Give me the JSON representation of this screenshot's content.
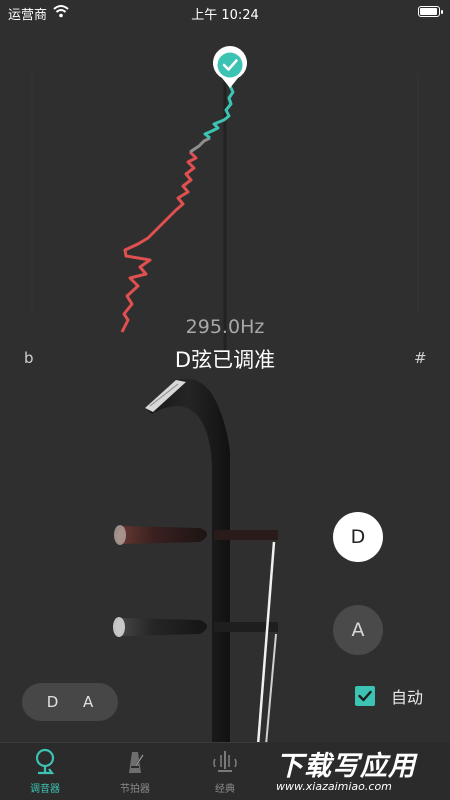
{
  "status_bar": {
    "carrier": "运营商",
    "time": "上午 10:24"
  },
  "tuner": {
    "flat_symbol": "b",
    "sharp_symbol": "#",
    "frequency": "295.0Hz",
    "status": "D弦已调准",
    "accent_color": "#3cc3b3",
    "off_color": "#e05050"
  },
  "strings": {
    "d_label": "D",
    "a_label": "A",
    "selected": "D"
  },
  "tuning_pill": "D A",
  "auto": {
    "label": "自动",
    "checked": true
  },
  "tabs": [
    {
      "label": "调音器",
      "icon": "tuner-pin-icon",
      "active": true
    },
    {
      "label": "节拍器",
      "icon": "metronome-icon",
      "active": false
    },
    {
      "label": "经典",
      "icon": "classic-icon",
      "active": false
    }
  ],
  "watermark": {
    "title": "下载写应用",
    "url": "www.xiazaimiao.com"
  }
}
